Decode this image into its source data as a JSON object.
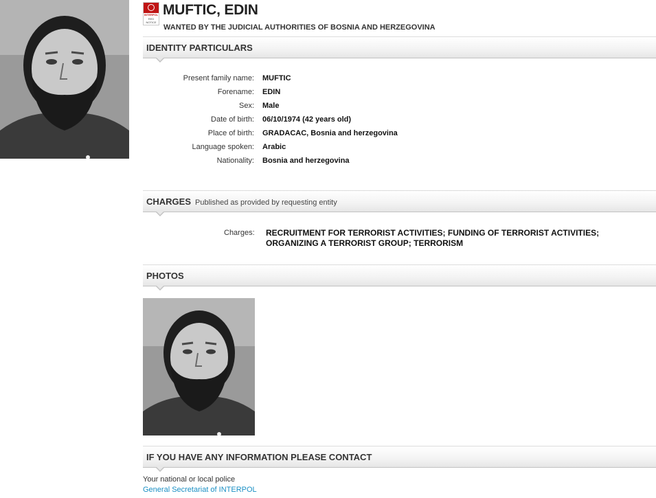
{
  "header": {
    "name": "MUFTIC, EDIN",
    "wanted_by": "WANTED BY THE JUDICIAL AUTHORITIES OF BOSNIA AND HERZEGOVINA",
    "logo": {
      "icon": "interpol-red-notice-icon",
      "line1": "INTERPOL",
      "line2": "RED",
      "line3": "NOTICE",
      "color": "#c01414"
    }
  },
  "identity": {
    "title": "IDENTITY PARTICULARS",
    "rows": [
      {
        "label": "Present family name:",
        "value": "MUFTIC"
      },
      {
        "label": "Forename:",
        "value": "EDIN"
      },
      {
        "label": "Sex:",
        "value": "Male"
      },
      {
        "label": "Date of birth:",
        "value": "06/10/1974 (42 years old)"
      },
      {
        "label": "Place of birth:",
        "value": "GRADACAC, Bosnia and herzegovina"
      },
      {
        "label": "Language spoken:",
        "value": "Arabic"
      },
      {
        "label": "Nationality:",
        "value": "Bosnia and herzegovina"
      }
    ]
  },
  "charges": {
    "title": "CHARGES",
    "subtitle": "Published as provided by requesting entity",
    "label": "Charges:",
    "value": "RECRUITMENT FOR TERRORIST ACTIVITIES; FUNDING OF TERRORIST ACTIVITIES; ORGANIZING A TERRORIST GROUP; TERRORISM"
  },
  "photos": {
    "title": "PHOTOS"
  },
  "contact": {
    "title": "IF YOU HAVE ANY INFORMATION PLEASE CONTACT",
    "police": "Your national or local police",
    "link": "General Secretariat of INTERPOL",
    "link_color": "#1a8fc4"
  }
}
